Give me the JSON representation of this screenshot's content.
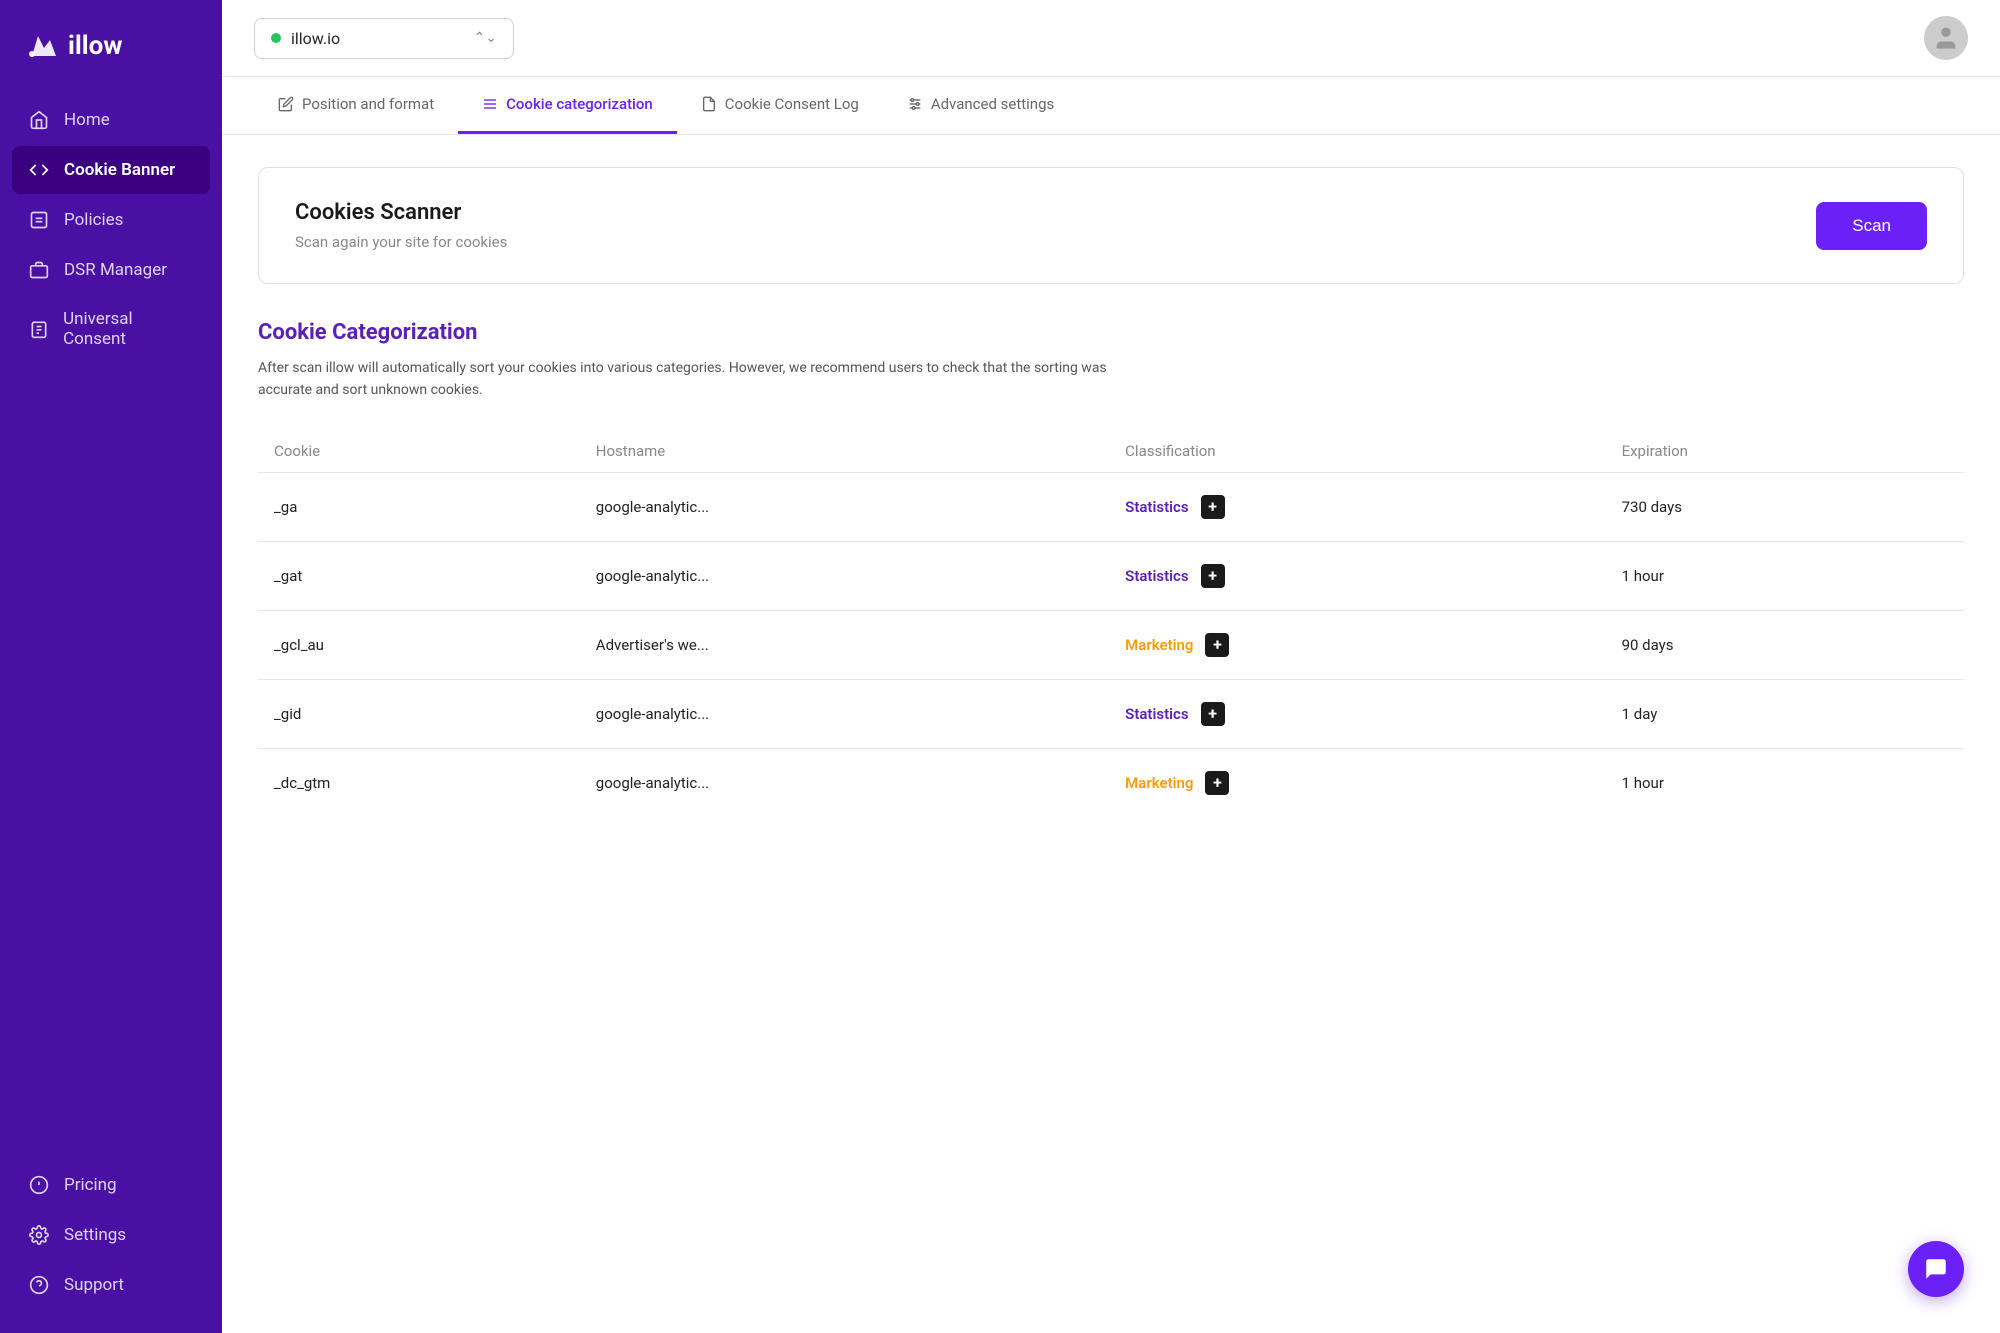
{
  "sidebar": {
    "logo": "illow",
    "items": [
      {
        "id": "home",
        "label": "Home",
        "icon": "home"
      },
      {
        "id": "cookie-banner",
        "label": "Cookie Banner",
        "icon": "code",
        "active": true
      },
      {
        "id": "policies",
        "label": "Policies",
        "icon": "file"
      },
      {
        "id": "dsr-manager",
        "label": "DSR Manager",
        "icon": "briefcase"
      },
      {
        "id": "universal-consent",
        "label": "Universal Consent",
        "icon": "clipboard"
      }
    ],
    "bottom_items": [
      {
        "id": "pricing",
        "label": "Pricing",
        "icon": "circle-dollar"
      },
      {
        "id": "settings",
        "label": "Settings",
        "icon": "gear"
      },
      {
        "id": "support",
        "label": "Support",
        "icon": "circle-question"
      }
    ]
  },
  "topbar": {
    "domain": "illow.io",
    "domain_status": "active"
  },
  "tabs": [
    {
      "id": "position-format",
      "label": "Position and format",
      "icon": "edit",
      "active": false
    },
    {
      "id": "cookie-categorization",
      "label": "Cookie categorization",
      "icon": "menu",
      "active": true
    },
    {
      "id": "cookie-consent-log",
      "label": "Cookie Consent Log",
      "icon": "doc"
    },
    {
      "id": "advanced-settings",
      "label": "Advanced settings",
      "icon": "sliders"
    }
  ],
  "scanner": {
    "title": "Cookies Scanner",
    "description": "Scan again your site for cookies",
    "scan_button": "Scan"
  },
  "categorization": {
    "title": "Cookie Categorization",
    "description": "After scan illow will automatically sort your cookies into various categories.  However, we recommend users to check that the sorting was accurate and sort unknown cookies.",
    "table": {
      "headers": [
        "Cookie",
        "Hostname",
        "Classification",
        "Expiration"
      ],
      "rows": [
        {
          "cookie": "_ga",
          "hostname": "google-analytic...",
          "classification": "Statistics",
          "classification_type": "stats",
          "expiration": "730 days"
        },
        {
          "cookie": "_gat",
          "hostname": "google-analytic...",
          "classification": "Statistics",
          "classification_type": "stats",
          "expiration": "1 hour"
        },
        {
          "cookie": "_gcl_au",
          "hostname": "Advertiser's we...",
          "classification": "Marketing",
          "classification_type": "marketing",
          "expiration": "90 days"
        },
        {
          "cookie": "_gid",
          "hostname": "google-analytic...",
          "classification": "Statistics",
          "classification_type": "stats",
          "expiration": "1 day"
        },
        {
          "cookie": "_dc_gtm",
          "hostname": "google-analytic...",
          "classification": "Marketing",
          "classification_type": "marketing",
          "expiration": "1 hour"
        }
      ]
    }
  },
  "colors": {
    "sidebar_bg": "#4a0fa3",
    "sidebar_active": "#3a0080",
    "accent": "#6b21f5",
    "stats_color": "#5b21b6",
    "marketing_color": "#f59e0b"
  }
}
